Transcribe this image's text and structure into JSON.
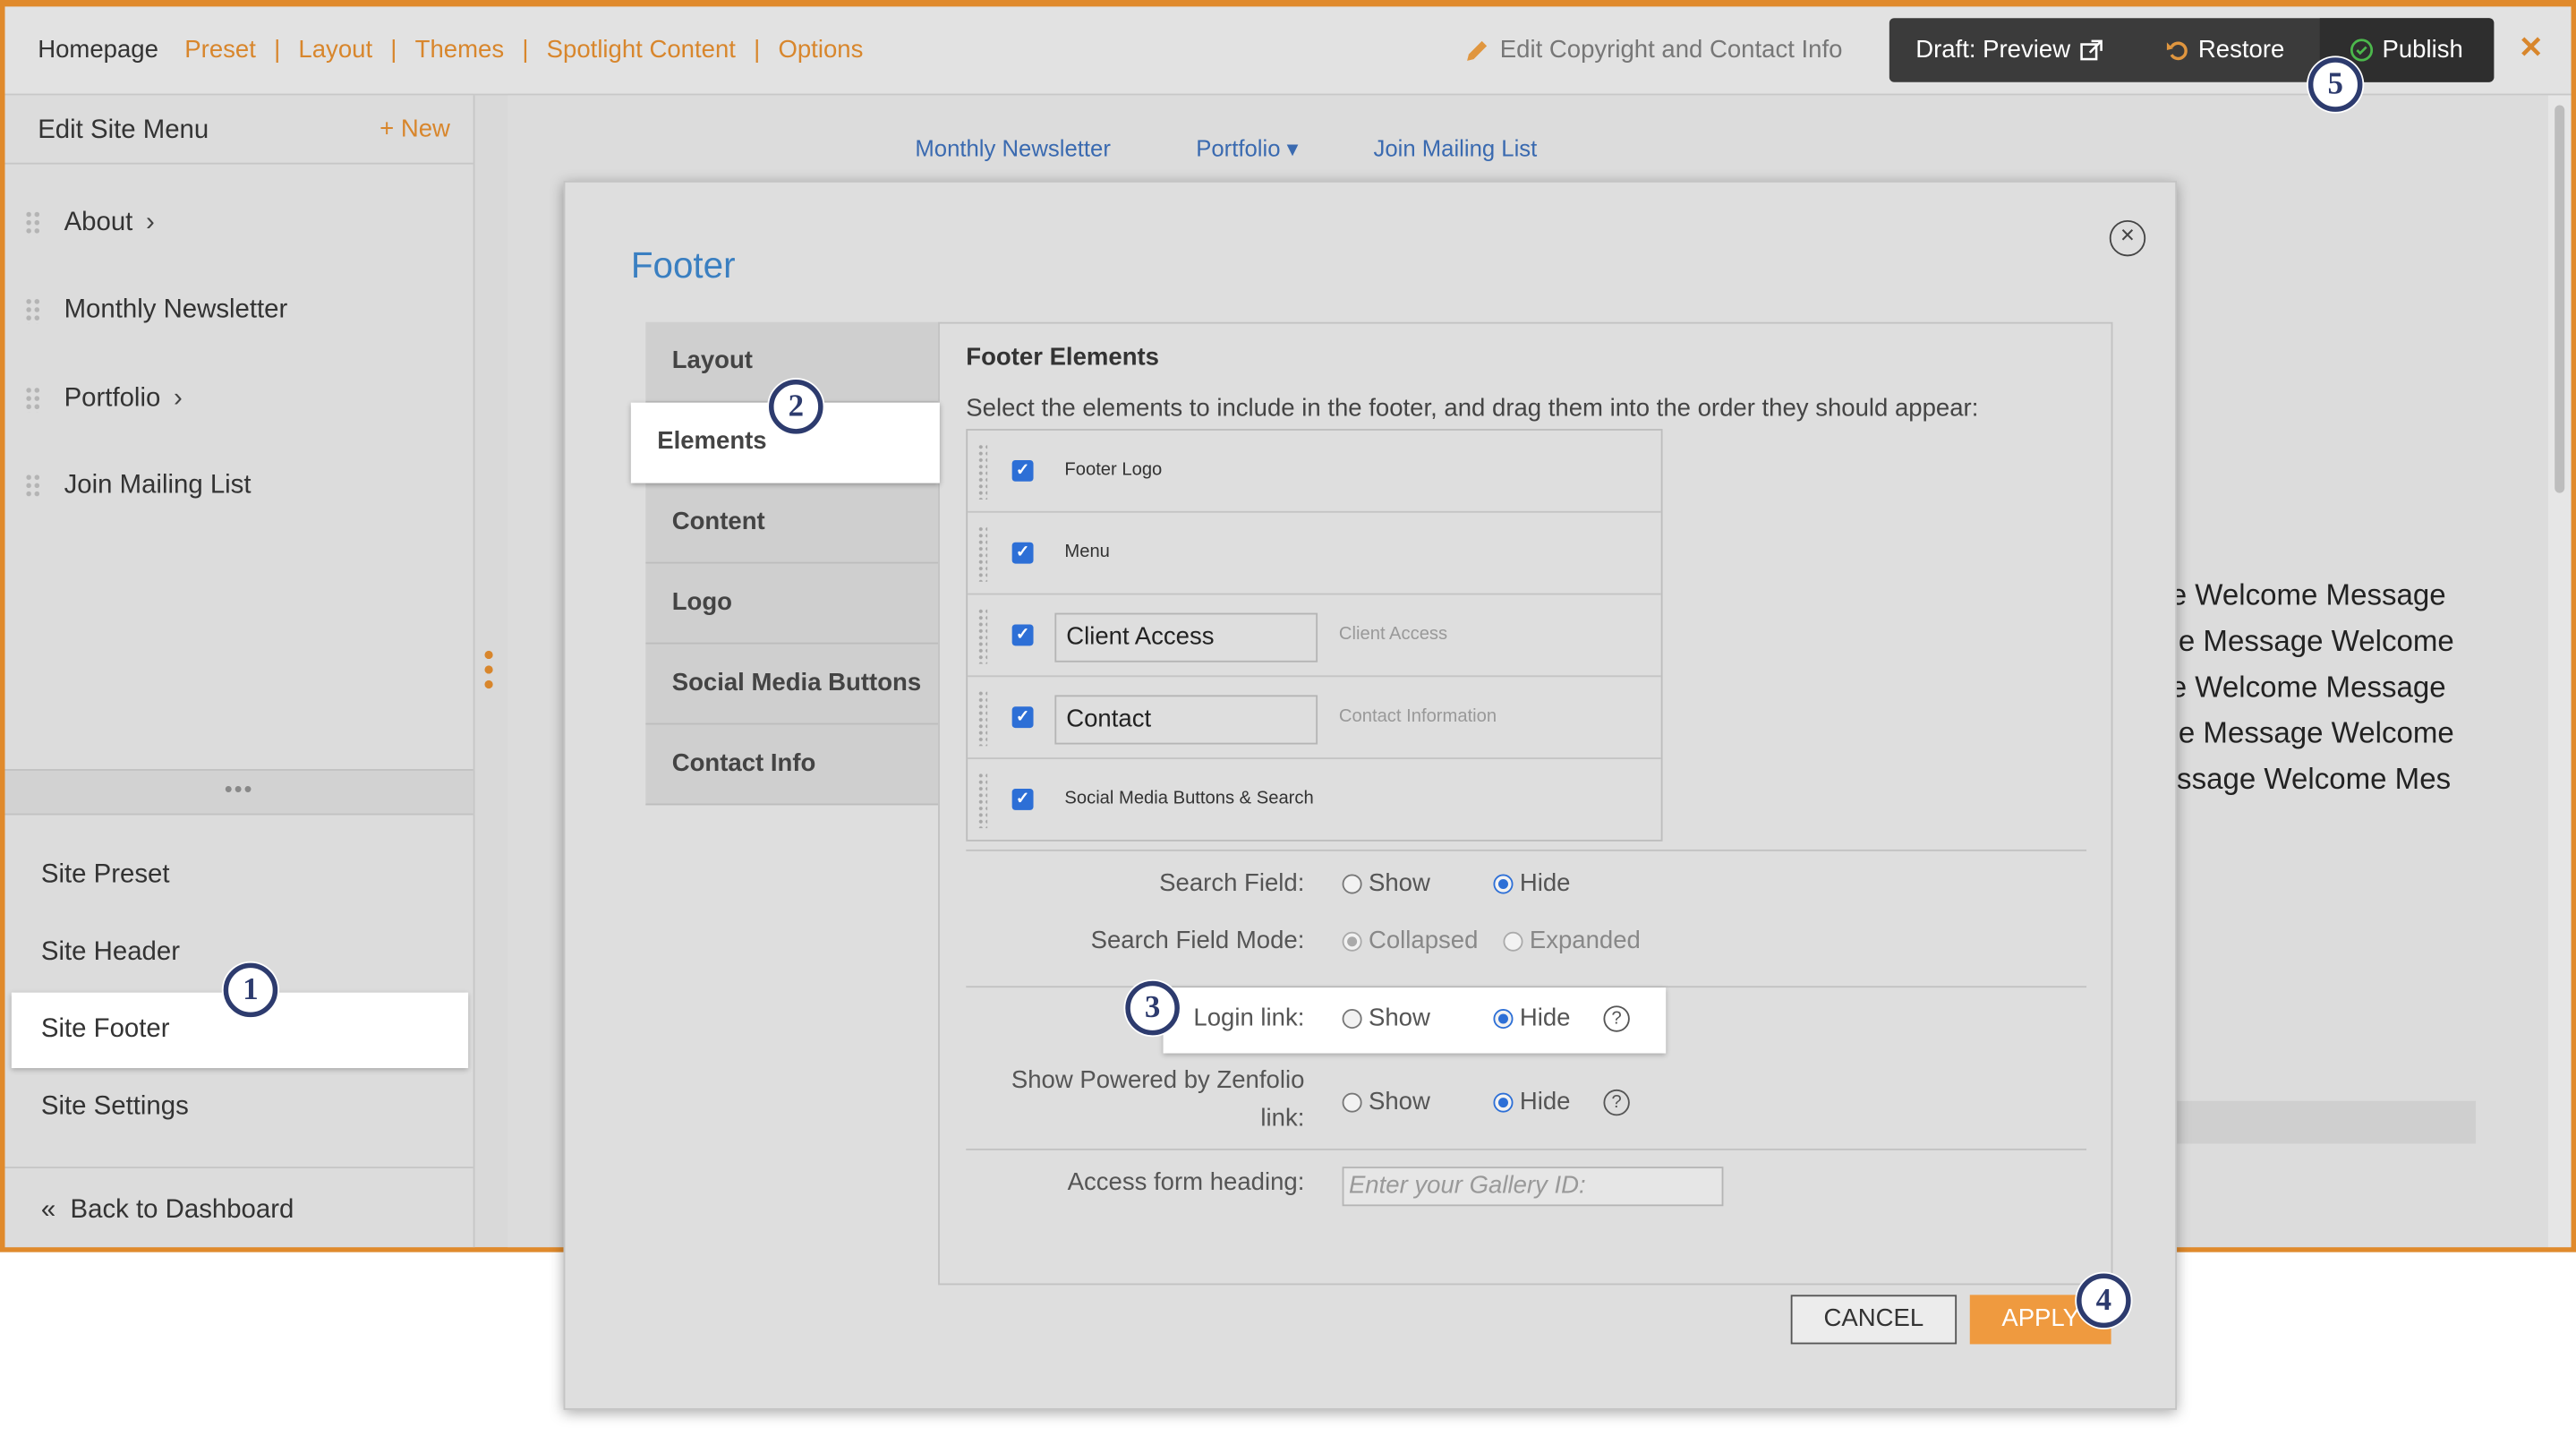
{
  "topbar": {
    "home": "Homepage",
    "links": [
      "Preset",
      "Layout",
      "Themes",
      "Spotlight Content",
      "Options"
    ],
    "edit_copyright": "Edit Copyright and Contact Info",
    "draft_preview": "Draft: Preview",
    "restore": "Restore",
    "publish": "Publish",
    "close": "✕"
  },
  "left_panel": {
    "title": "Edit Site Menu",
    "new_label": "New",
    "menu_items": [
      {
        "label": "About",
        "has_children": true
      },
      {
        "label": "Monthly Newsletter",
        "has_children": false
      },
      {
        "label": "Portfolio",
        "has_children": true
      },
      {
        "label": "Join Mailing List",
        "has_children": false
      }
    ],
    "divider_dots": "•••",
    "site_items": [
      "Site Preset",
      "Site Header",
      "Site Footer",
      "Site Settings"
    ],
    "active_site_item": "Site Footer",
    "back": "Back to Dashboard"
  },
  "preview": {
    "nav": [
      "Monthly Newsletter",
      "Portfolio ▾",
      "Join Mailing List"
    ],
    "welcome_lines": [
      "ge Welcome Message",
      "me Message Welcome",
      "ge Welcome Message",
      "me Message Welcome",
      "lessage Welcome Mes"
    ]
  },
  "modal": {
    "title": "Footer",
    "tabs": [
      "Layout",
      "Elements",
      "Content",
      "Logo",
      "Social Media Buttons",
      "Contact Info"
    ],
    "active_tab": "Elements",
    "section_title": "Footer Elements",
    "description": "Select the elements to include in the footer, and drag them into the order they should appear:",
    "elements": [
      {
        "label": "Footer Logo",
        "checked": true,
        "editable": false,
        "hint": ""
      },
      {
        "label": "Menu",
        "checked": true,
        "editable": false,
        "hint": ""
      },
      {
        "label": "Client Access",
        "checked": true,
        "editable": true,
        "hint": "Client Access"
      },
      {
        "label": "Contact",
        "checked": true,
        "editable": true,
        "hint": "Contact Information"
      },
      {
        "label": "Social Media Buttons & Search",
        "checked": true,
        "editable": false,
        "hint": ""
      }
    ],
    "search_field": {
      "label": "Search Field:",
      "show": "Show",
      "hide": "Hide",
      "selected": "Hide"
    },
    "search_mode": {
      "label": "Search Field Mode:",
      "collapsed": "Collapsed",
      "expanded": "Expanded",
      "selected": "Collapsed"
    },
    "login_link": {
      "label": "Login link:",
      "show": "Show",
      "hide": "Hide",
      "selected": "Hide"
    },
    "powered_by": {
      "label_line1": "Show Powered by Zenfolio",
      "label_line2": "link:",
      "show": "Show",
      "hide": "Hide",
      "selected": "Hide"
    },
    "access_heading": {
      "label": "Access form heading:",
      "placeholder": "Enter your Gallery ID:"
    },
    "cancel": "CANCEL",
    "apply": "APPLY",
    "help": "?"
  },
  "callouts": [
    "1",
    "2",
    "3",
    "4",
    "5"
  ],
  "colors": {
    "accent": "#d8862c",
    "link_blue": "#3a7fc1",
    "callout": "#2d3b6e",
    "apply": "#ef9a3f"
  }
}
